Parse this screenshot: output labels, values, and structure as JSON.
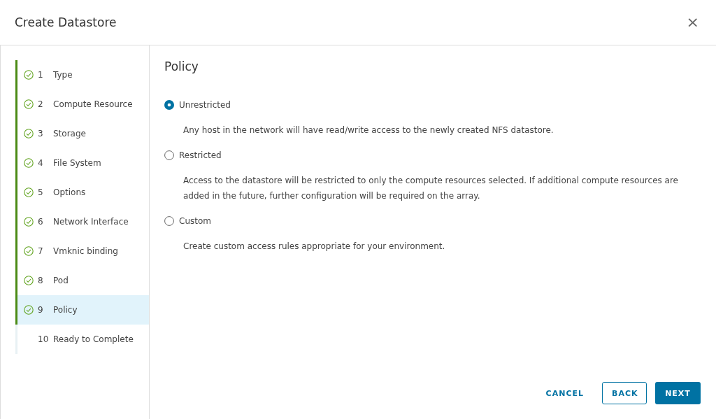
{
  "dialog": {
    "title": "Create Datastore",
    "close": "×"
  },
  "steps": [
    {
      "number": "1",
      "label": "Type",
      "completed": true,
      "selected": false
    },
    {
      "number": "2",
      "label": "Compute Resource",
      "completed": true,
      "selected": false
    },
    {
      "number": "3",
      "label": "Storage",
      "completed": true,
      "selected": false
    },
    {
      "number": "4",
      "label": "File System",
      "completed": true,
      "selected": false
    },
    {
      "number": "5",
      "label": "Options",
      "completed": true,
      "selected": false
    },
    {
      "number": "6",
      "label": "Network Interface",
      "completed": true,
      "selected": false
    },
    {
      "number": "7",
      "label": "Vmknic binding",
      "completed": true,
      "selected": false
    },
    {
      "number": "8",
      "label": "Pod",
      "completed": true,
      "selected": false
    },
    {
      "number": "9",
      "label": "Policy",
      "completed": true,
      "selected": true
    },
    {
      "number": "10",
      "label": "Ready to Complete",
      "completed": false,
      "selected": false
    }
  ],
  "page": {
    "heading": "Policy",
    "options": [
      {
        "label": "Unrestricted",
        "description": "Any host in the network will have read/write access to the newly created NFS datastore.",
        "selected": true
      },
      {
        "label": "Restricted",
        "description": "Access to the datastore will be restricted to only the compute resources selected. If additional compute resources are added in the future, further configuration will be required on the array.",
        "selected": false
      },
      {
        "label": "Custom",
        "description": "Create custom access rules appropriate for your environment.",
        "selected": false
      }
    ]
  },
  "buttons": [
    {
      "label": "CANCEL",
      "kind": "flat"
    },
    {
      "label": "BACK",
      "kind": "outline"
    },
    {
      "label": "NEXT",
      "kind": "primary"
    }
  ]
}
